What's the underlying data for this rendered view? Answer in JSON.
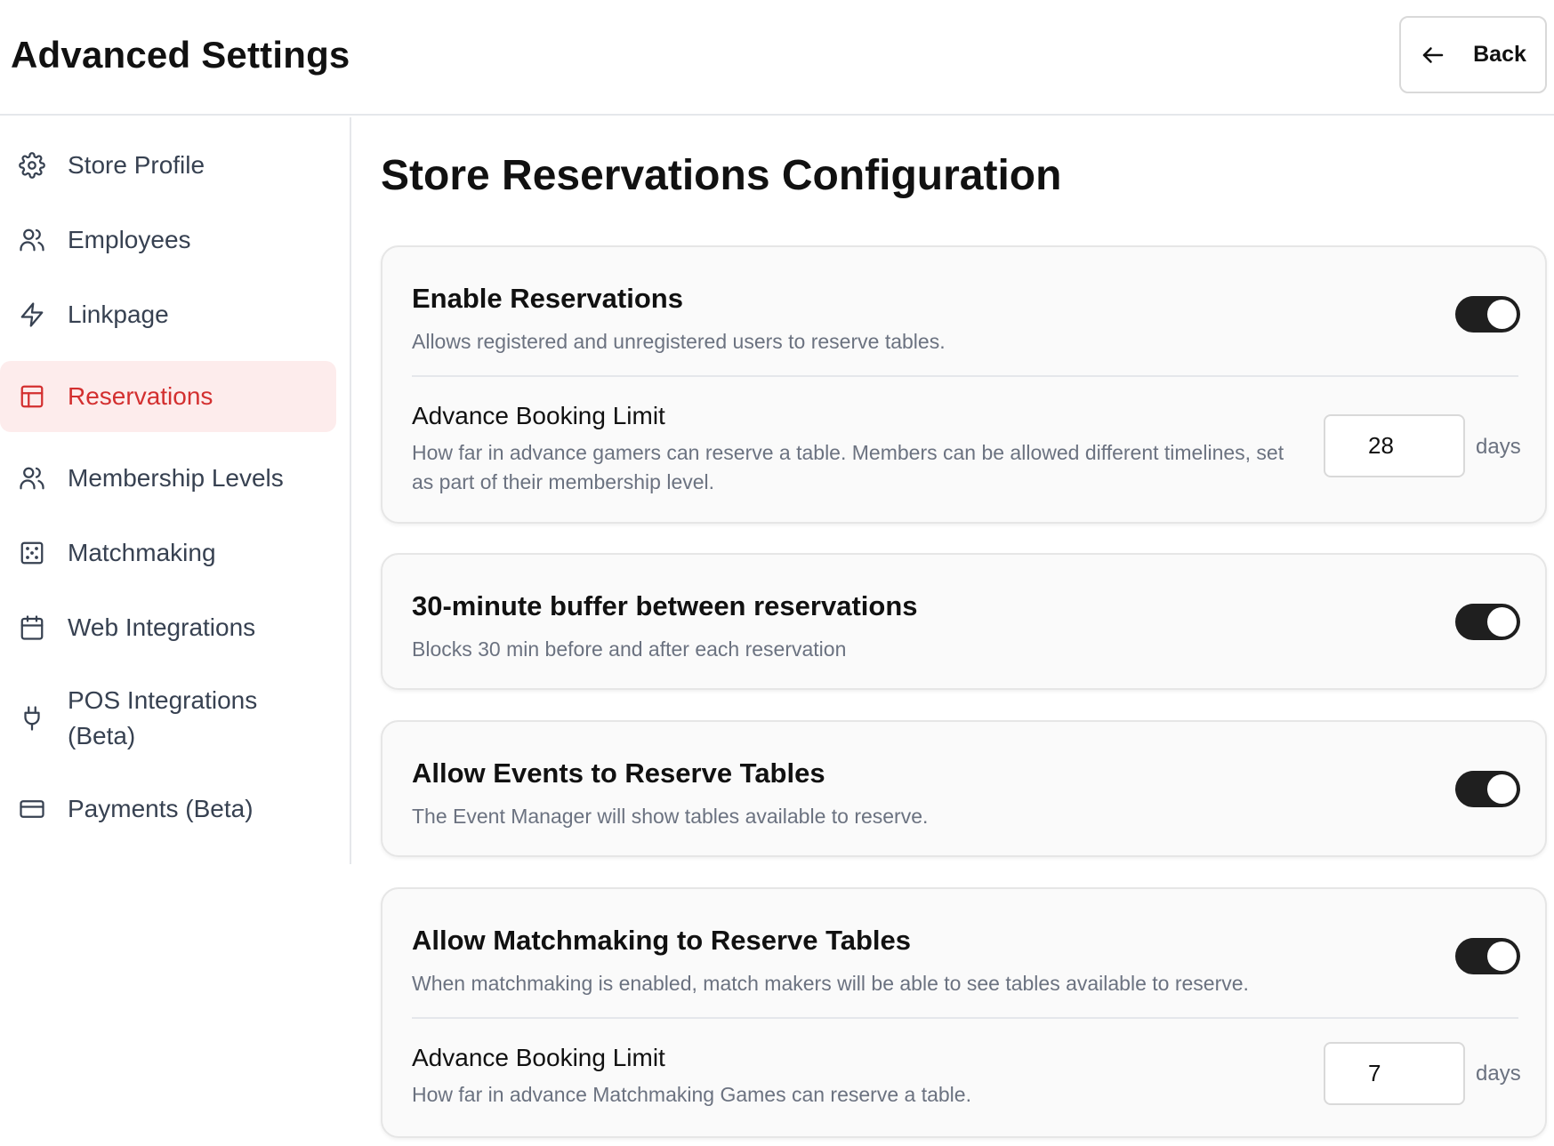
{
  "header": {
    "title": "Advanced Settings",
    "back_label": "Back"
  },
  "sidebar": {
    "items": [
      {
        "label": "Store Profile",
        "icon": "gear-icon"
      },
      {
        "label": "Employees",
        "icon": "users-icon"
      },
      {
        "label": "Linkpage",
        "icon": "lightning-icon"
      },
      {
        "label": "Reservations",
        "icon": "table-icon",
        "active": true
      },
      {
        "label": "Membership Levels",
        "icon": "users-icon"
      },
      {
        "label": "Matchmaking",
        "icon": "dice-icon"
      },
      {
        "label": "Web Integrations",
        "icon": "calendar-icon"
      },
      {
        "label": "POS Integrations (Beta)",
        "icon": "plug-icon"
      },
      {
        "label": "Payments (Beta)",
        "icon": "credit-card-icon"
      }
    ]
  },
  "main": {
    "title": "Store Reservations Configuration",
    "enable_reservations": {
      "title": "Enable Reservations",
      "desc": "Allows registered and unregistered users to reserve tables.",
      "enabled": true
    },
    "advance_booking": {
      "title": "Advance Booking Limit",
      "desc": "How far in advance gamers can reserve a table. Members can be allowed different timelines, set as part of their membership level.",
      "value": "28",
      "unit": "days"
    },
    "buffer": {
      "title": "30-minute buffer between reservations",
      "desc": "Blocks 30 min before and after each reservation",
      "enabled": true
    },
    "events": {
      "title": "Allow Events to Reserve Tables",
      "desc": "The Event Manager will show tables available to reserve.",
      "enabled": true
    },
    "matchmaking": {
      "title": "Allow Matchmaking to Reserve Tables",
      "desc": "When matchmaking is enabled, match makers will be able to see tables available to reserve.",
      "enabled": true
    },
    "mm_booking": {
      "title": "Advance Booking Limit",
      "desc": "How far in advance Matchmaking Games can reserve a table.",
      "value": "7",
      "unit": "days"
    }
  },
  "colors": {
    "accent_red": "#d32f2f",
    "active_bg": "#fdecec",
    "toggle_on": "#1f1f1f"
  }
}
